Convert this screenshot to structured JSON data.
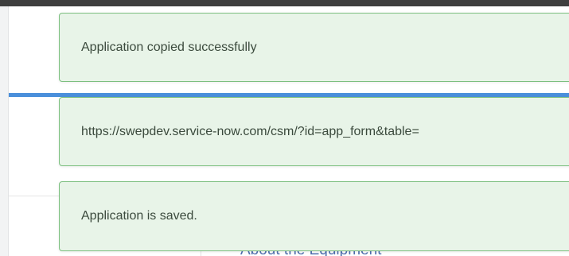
{
  "notifications": [
    {
      "message": "Application copied successfully"
    },
    {
      "message": "https://swepdev.service-now.com/csm/?id=app_form&table="
    },
    {
      "message": "Application is saved."
    }
  ],
  "background": {
    "section_link": "About the Equipment"
  },
  "colors": {
    "toast_background": "#e8f4e8",
    "toast_border": "#7cbf7f",
    "toast_text": "#3b4a3d",
    "accent_strip": "#4a8fdb",
    "top_bar": "#3e3e3e",
    "link": "#4e6fae"
  }
}
